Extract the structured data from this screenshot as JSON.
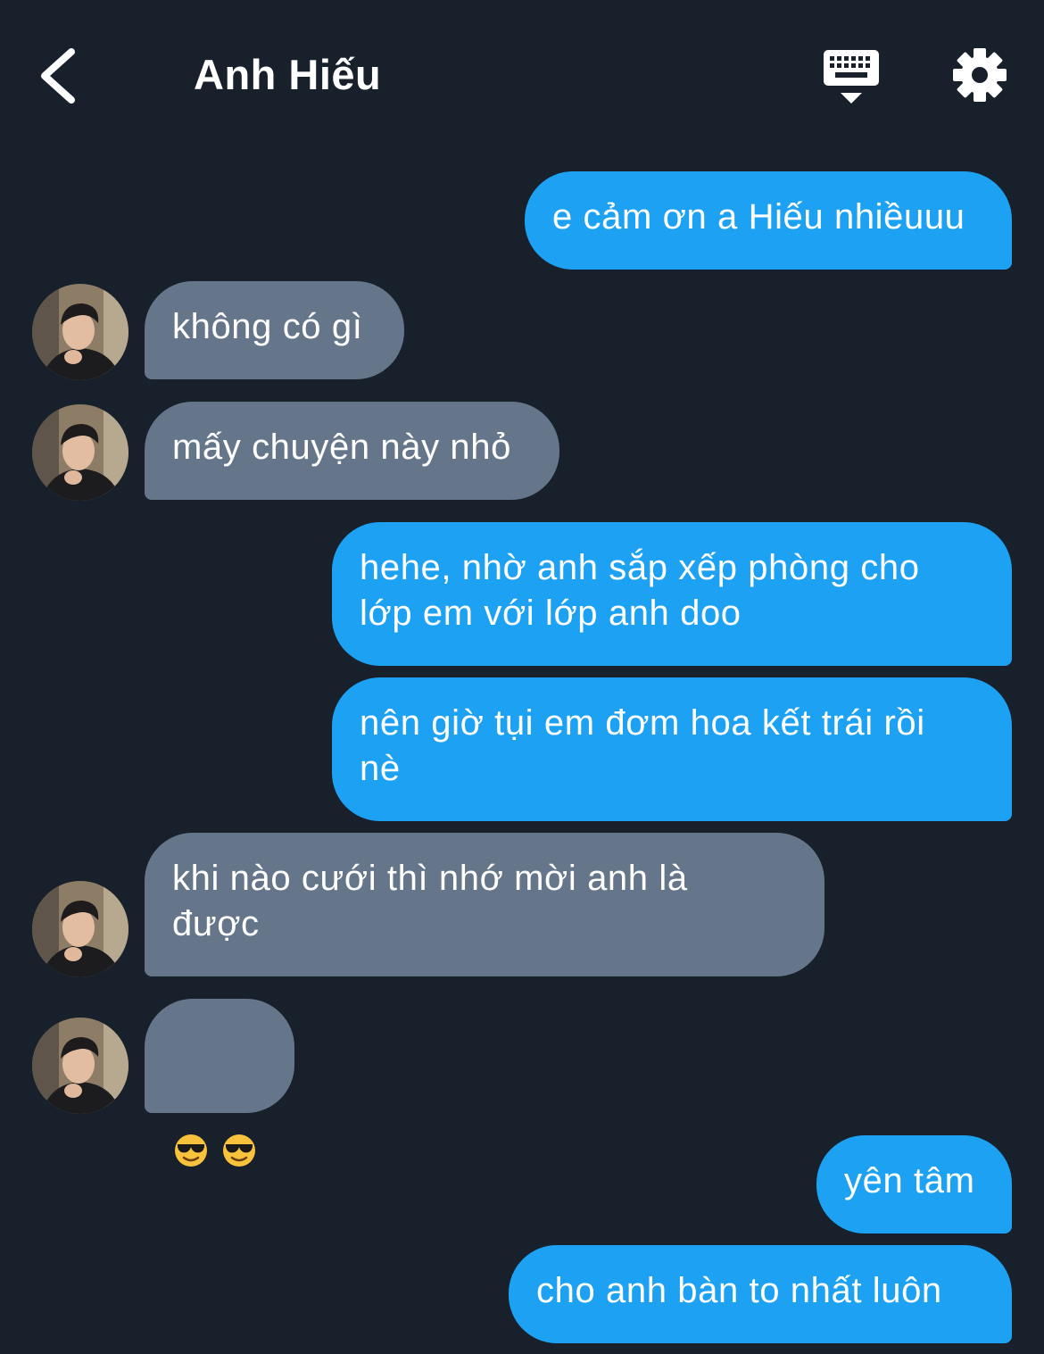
{
  "header": {
    "title": "Anh Hiếu",
    "back_icon": "chevron-left-icon",
    "keyboard_icon": "keyboard-hide-icon",
    "settings_icon": "gear-icon"
  },
  "colors": {
    "background": "#17202b",
    "sent_bubble": "#1da1f2",
    "received_bubble": "#66768a",
    "text": "#ffffff"
  },
  "messages": [
    {
      "from": "me",
      "text": "e cảm ơn a Hiếu nhiềuuu"
    },
    {
      "from": "Anh Hiếu",
      "text": "không có gì"
    },
    {
      "from": "Anh Hiếu",
      "text": "mấy chuyện này nhỏ"
    },
    {
      "from": "me",
      "text": "hehe, nhờ anh sắp xếp phòng cho\nlớp em với lớp anh doo"
    },
    {
      "from": "me",
      "text": "nên giờ tụi em đơm hoa kết trái rồi\nnè"
    },
    {
      "from": "Anh Hiếu",
      "text": "khi nào cưới thì nhớ mời anh là\nđược"
    },
    {
      "from": "Anh Hiếu",
      "emoji": [
        "smiling-face-with-sunglasses",
        "smiling-face-with-sunglasses"
      ]
    },
    {
      "from": "me",
      "text": "yên tâm"
    },
    {
      "from": "me",
      "text": "cho anh bàn to nhất luôn"
    }
  ]
}
